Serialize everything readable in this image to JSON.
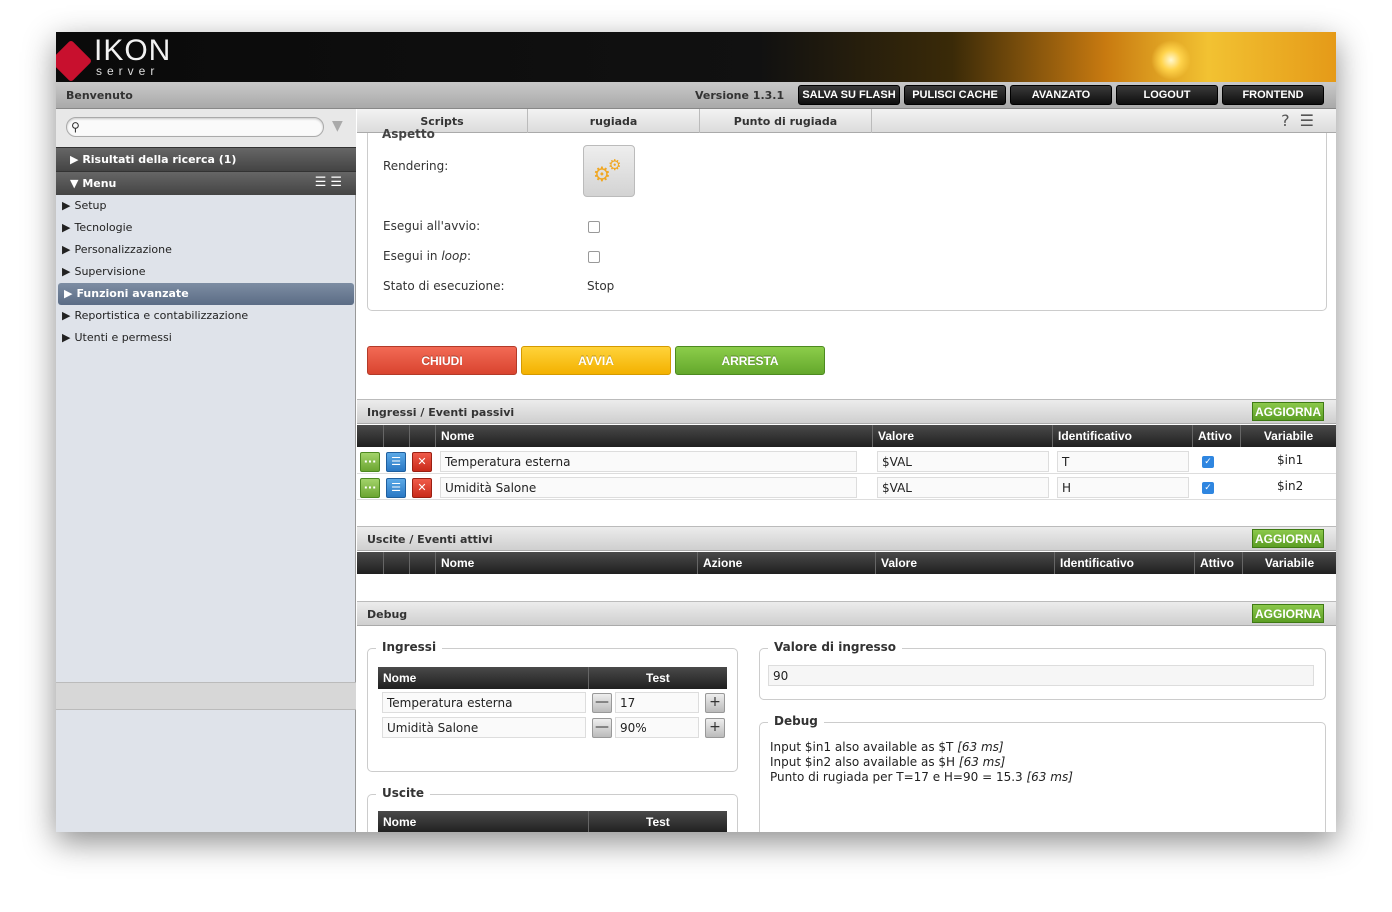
{
  "brand": {
    "logo_main": "IKON",
    "logo_sub": "server"
  },
  "menubar": {
    "welcome": "Benvenuto",
    "version": "Versione 1.3.1",
    "buttons": [
      "SALVA SU FLASH",
      "PULISCI CACHE",
      "AVANZATO",
      "LOGOUT",
      "FRONTEND"
    ]
  },
  "sidebar": {
    "search_placeholder": "",
    "results_header": "Risultati della ricerca (1)",
    "menu_header": "Menu",
    "items": [
      "Setup",
      "Tecnologie",
      "Personalizzazione",
      "Supervisione",
      "Funzioni avanzate",
      "Reportistica e contabilizzazione",
      "Utenti e permessi"
    ],
    "active_item": "Funzioni avanzate"
  },
  "tabs": [
    "Scripts",
    "rugiada",
    "Punto di rugiada"
  ],
  "aspect": {
    "legend": "Aspetto",
    "rendering_label": "Rendering:",
    "run_on_start_label": "Esegui all'avvio:",
    "run_loop_prefix": "Esegui in ",
    "run_loop_italic": "loop",
    "run_loop_suffix": ":",
    "state_label": "Stato di esecuzione:",
    "state_value": "Stop",
    "run_on_start_checked": false,
    "run_loop_checked": false
  },
  "actions": {
    "close": "CHIUDI",
    "start": "AVVIA",
    "stop": "ARRESTA"
  },
  "inputs_section": {
    "title": "Ingressi / Eventi passivi",
    "refresh": "AGGIORNA",
    "columns": [
      "Nome",
      "Valore",
      "Identificativo",
      "Attivo",
      "Variabile"
    ],
    "rows": [
      {
        "name": "Temperatura esterna",
        "value": "$VAL",
        "id": "T",
        "active": true,
        "variable": "$in1"
      },
      {
        "name": "Umidità Salone",
        "value": "$VAL",
        "id": "H",
        "active": true,
        "variable": "$in2"
      }
    ]
  },
  "outputs_section": {
    "title": "Uscite / Eventi attivi",
    "refresh": "AGGIORNA",
    "columns": [
      "Nome",
      "Azione",
      "Valore",
      "Identificativo",
      "Attivo",
      "Variabile"
    ]
  },
  "debug_section": {
    "title": "Debug",
    "refresh": "AGGIORNA",
    "inputs_legend": "Ingressi",
    "inputs_columns": [
      "Nome",
      "Test"
    ],
    "inputs_rows": [
      {
        "name": "Temperatura esterna",
        "test": "17"
      },
      {
        "name": "Umidità Salone",
        "test": "90%"
      }
    ],
    "outputs_legend": "Uscite",
    "outputs_columns": [
      "Nome",
      "Test"
    ],
    "input_value_legend": "Valore di ingresso",
    "input_value": "90",
    "debug_legend": "Debug",
    "debug_lines": [
      {
        "text": "Input $in1 also available as $T ",
        "time": "[63 ms]"
      },
      {
        "text": "Input $in2 also available as $H ",
        "time": "[63 ms]"
      },
      {
        "text": "Punto di rugiada per T=17 e H=90 = 15.3 ",
        "time": "[63 ms]"
      }
    ]
  },
  "colors": {
    "accent_red": "#d9442f",
    "accent_yellow": "#f3b100",
    "accent_green": "#64a82c",
    "active_nav": "#5b6c85"
  },
  "icons": [
    "search-icon",
    "filter-icon",
    "help-icon",
    "log-icon",
    "gear-icon",
    "edit-icon",
    "list-icon",
    "delete-icon",
    "minus-icon",
    "plus-icon"
  ]
}
